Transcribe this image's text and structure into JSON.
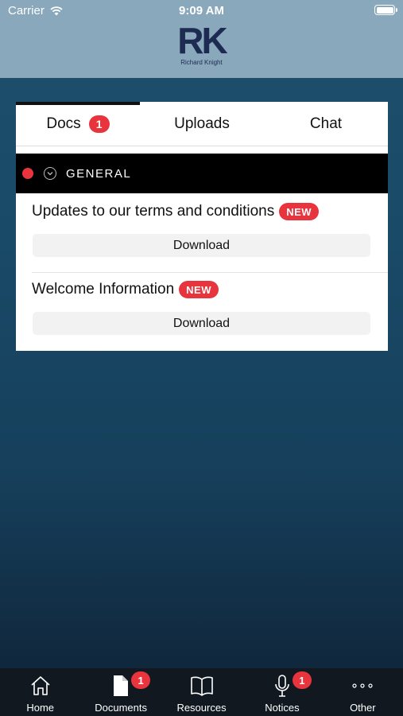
{
  "status_bar": {
    "carrier": "Carrier",
    "time": "9:09 AM"
  },
  "logo": {
    "mark": "RK",
    "subtitle": "Richard Knight"
  },
  "tabs": [
    {
      "label": "Docs",
      "badge": "1",
      "active": true
    },
    {
      "label": "Uploads"
    },
    {
      "label": "Chat"
    }
  ],
  "section": {
    "title": "GENERAL"
  },
  "documents": [
    {
      "title": "Updates to our terms and conditions",
      "badge": "NEW",
      "action": "Download"
    },
    {
      "title": "Welcome Information",
      "badge": "NEW",
      "action": "Download"
    }
  ],
  "tabbar": [
    {
      "label": "Home",
      "icon": "home-icon"
    },
    {
      "label": "Documents",
      "icon": "document-icon",
      "badge": "1"
    },
    {
      "label": "Resources",
      "icon": "book-icon"
    },
    {
      "label": "Notices",
      "icon": "microphone-icon",
      "badge": "1"
    },
    {
      "label": "Other",
      "icon": "more-icon"
    }
  ],
  "colors": {
    "header": "#8aa8bb",
    "accent": "#e8343d",
    "logo": "#1d2a52",
    "tabbar": "#111820"
  }
}
